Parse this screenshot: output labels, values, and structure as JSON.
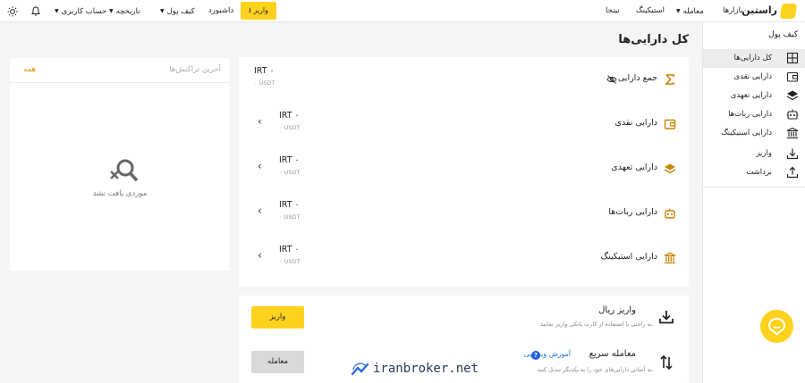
{
  "topbar": {
    "logo_text": "راستین",
    "markets": "بازارها",
    "trade": "معامله",
    "staking": "استیکینگ",
    "ninja": "نینجا",
    "deposit_button": "واریز",
    "dashboard": "داشبورد",
    "wallet": "کیف پول",
    "history": "تاریخچه",
    "account": "حساب کاربری"
  },
  "sidebar": {
    "title": "کیف پول",
    "items": [
      {
        "label": "کل دارایی‌ها",
        "icon": "grid-icon"
      },
      {
        "label": "دارایی نقدی",
        "icon": "wallet-icon"
      },
      {
        "label": "دارایی تعهدی",
        "icon": "layers-icon"
      },
      {
        "label": "دارایی ربات‌ها",
        "icon": "robot-icon"
      },
      {
        "label": "دارایی استیکینگ",
        "icon": "bank-icon"
      },
      {
        "label": "واریز",
        "icon": "download-icon"
      },
      {
        "label": "برداشت",
        "icon": "upload-icon"
      }
    ]
  },
  "page_title": "کل دارایی‌ها",
  "transactions": {
    "title": "آخرین تراکنش‌ها",
    "all_link": "همه",
    "empty_text": "موردی یافت نشد"
  },
  "assets": {
    "total": {
      "label": "جمع دارایی",
      "irt": "IRT ۰",
      "usdt": "۰ USDT"
    },
    "rows": [
      {
        "label": "دارایی نقدی",
        "irt": "IRT ۰",
        "usdt": "۰ USDT"
      },
      {
        "label": "دارایی تعهدی",
        "irt": "IRT ۰",
        "usdt": "۰ USDT"
      },
      {
        "label": "دارایی ربات‌ها",
        "irt": "IRT ۰",
        "usdt": "۰ USDT"
      },
      {
        "label": "دارایی استیکینگ",
        "irt": "IRT ۰",
        "usdt": "۰ USDT"
      }
    ]
  },
  "actions": {
    "rial_deposit": {
      "title": "واریز ریال",
      "desc": "به راحتی با استفاده از کارت بانکی واریز نمایید.",
      "button": "واریز"
    },
    "quick_trade": {
      "title": "معامله سریع",
      "video_link": "آموزش ویدیویی",
      "desc": "به آسانی دارایی‌های خود را به یکدیگر تبدیل کنید.",
      "button": "معامله"
    }
  },
  "watermark": "iranbroker.net",
  "colors": {
    "accent": "#ffd21e",
    "link": "#1e73d8",
    "link_orange": "#e08a00"
  }
}
